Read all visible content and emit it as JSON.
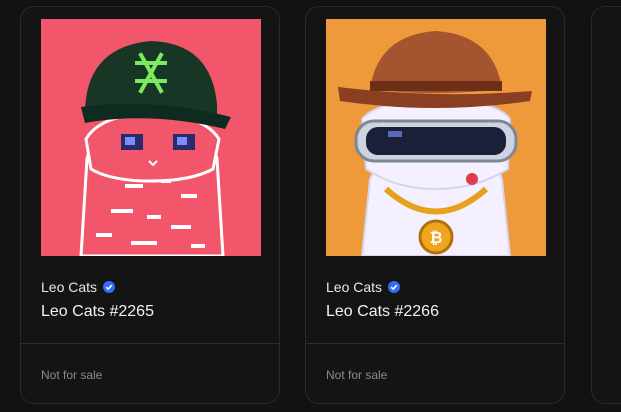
{
  "cards": [
    {
      "collection": "Leo Cats",
      "title": "Leo Cats #2265",
      "status": "Not for sale",
      "verified": true,
      "background": "#f1566a"
    },
    {
      "collection": "Leo Cats",
      "title": "Leo Cats #2266",
      "status": "Not for sale",
      "verified": true,
      "background": "#ee9a3a"
    }
  ],
  "colors": {
    "page_bg": "#121212",
    "verified_badge": "#2f6bff"
  }
}
